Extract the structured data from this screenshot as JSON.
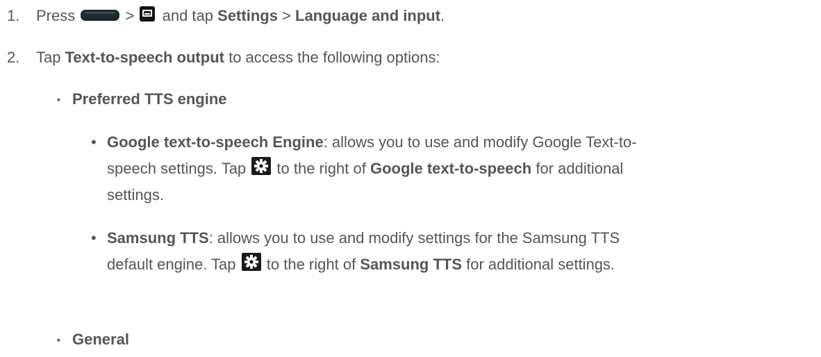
{
  "steps": [
    {
      "number": "1.",
      "t1": "Press",
      "t2": ">",
      "t3": "and tap",
      "b1": "Settings",
      "t4": ">",
      "b2": "Language and input",
      "t5": "."
    },
    {
      "number": "2.",
      "t1": "Tap",
      "b1": "Text-to-speech output",
      "t2": "to access the following options:"
    }
  ],
  "options": [
    {
      "bullet": "▪",
      "title": "Preferred TTS engine",
      "sub": [
        {
          "bullet": "•",
          "title": "Google text-to-speech Engine",
          "line1": ": allows you to use and modify Google Text-to-",
          "line2a": "speech settings. Tap",
          "line2b": "to the right of",
          "line2bold": "Google text-to-speech",
          "line2c": "for additional",
          "line3": "settings."
        },
        {
          "bullet": "•",
          "title": "Samsung TTS",
          "line1": ": allows you to use and modify settings for the Samsung TTS",
          "line2a": "default engine. Tap",
          "line2b": "to the right of",
          "line2bold": "Samsung TTS",
          "line2c": "for additional settings."
        }
      ]
    },
    {
      "bullet": "▪",
      "title": "General"
    }
  ],
  "icons": {
    "home": "home-key-icon",
    "menu": "menu-key-icon",
    "settings": "gear-icon"
  }
}
